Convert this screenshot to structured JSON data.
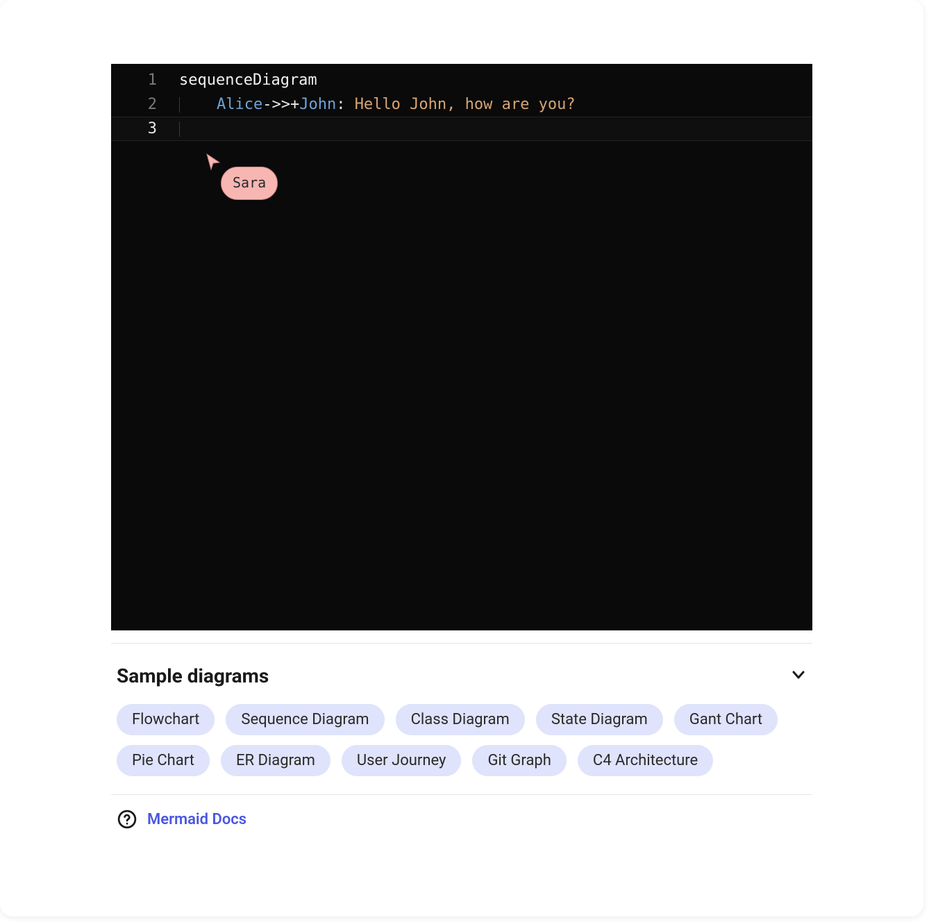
{
  "editor": {
    "line_numbers": [
      "1",
      "2",
      "3"
    ],
    "active_line_index": 2,
    "line1": {
      "keyword": "sequenceDiagram"
    },
    "line2": {
      "indent": "    ",
      "actor1": "Alice",
      "arrow": "->>+",
      "actor2": "John",
      "colon": ": ",
      "message": "Hello John, how are you?"
    },
    "collab_cursor": {
      "user": "Sara",
      "color": "#f8b6b3"
    }
  },
  "samples": {
    "title": "Sample diagrams",
    "items": [
      "Flowchart",
      "Sequence Diagram",
      "Class Diagram",
      "State Diagram",
      "Gant Chart",
      "Pie Chart",
      "ER Diagram",
      "User Journey",
      "Git Graph",
      "C4 Architecture"
    ]
  },
  "footer": {
    "docs_label": "Mermaid Docs"
  }
}
